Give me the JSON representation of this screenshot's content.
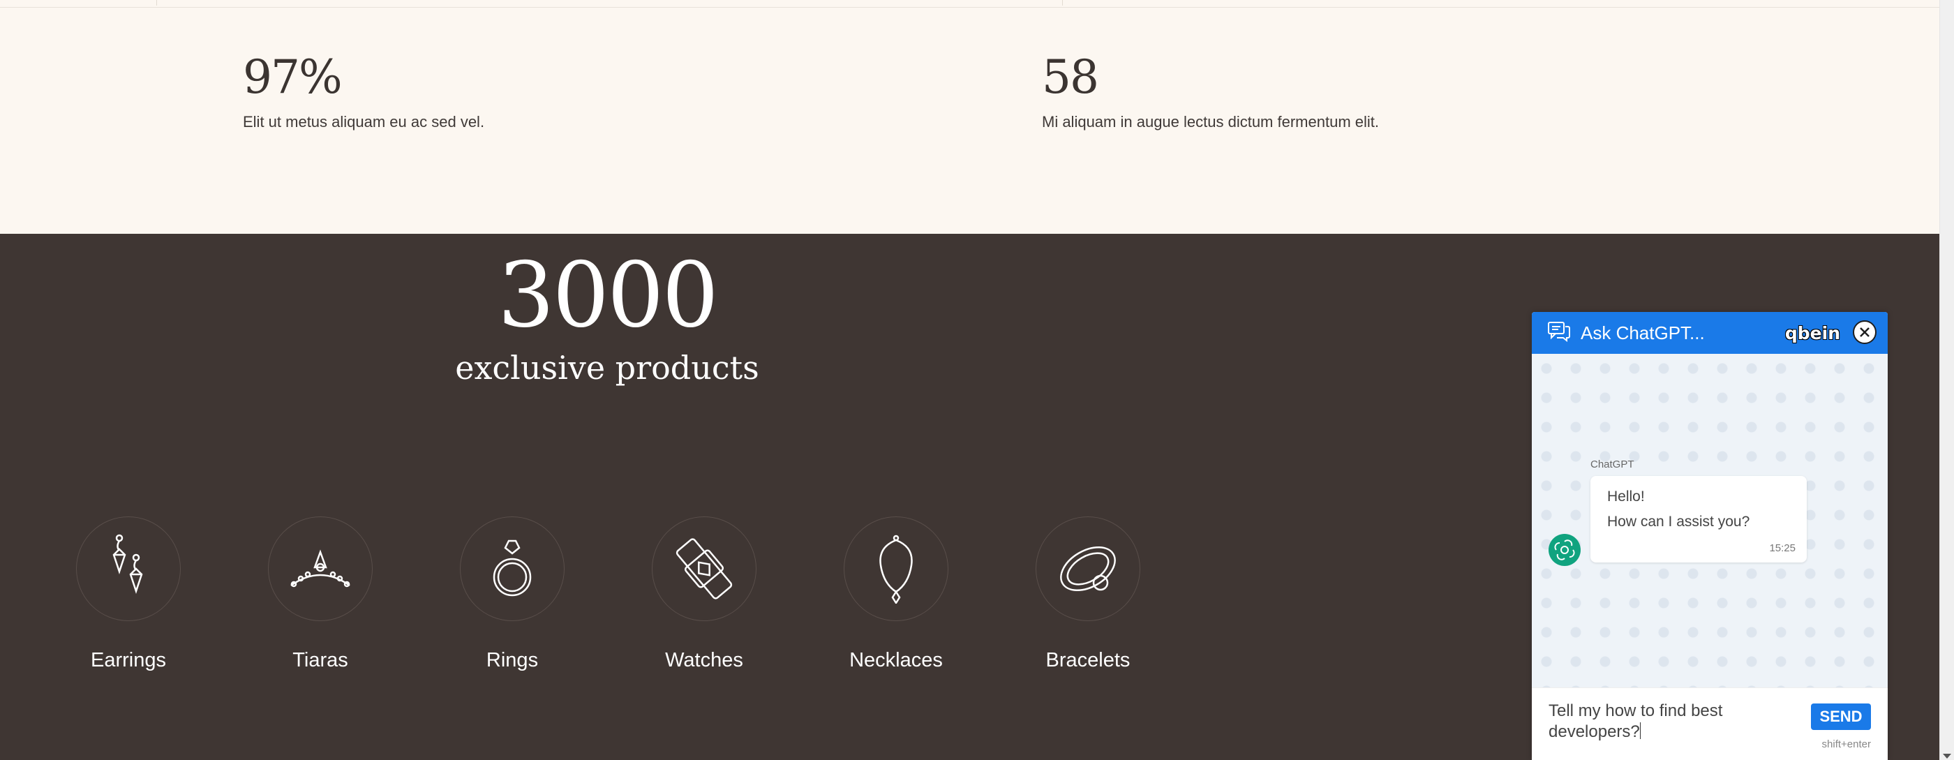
{
  "stats": [
    {
      "number": "97%",
      "text": "Elit ut metus aliquam eu ac sed vel."
    },
    {
      "number": "58",
      "text": "Mi aliquam in augue lectus dictum fermentum elit."
    }
  ],
  "highlight": {
    "number": "3000",
    "subtitle": "exclusive products"
  },
  "categories": [
    {
      "label": "Earrings",
      "icon": "earrings-icon"
    },
    {
      "label": "Tiaras",
      "icon": "tiara-icon"
    },
    {
      "label": "Rings",
      "icon": "ring-icon"
    },
    {
      "label": "Watches",
      "icon": "watch-icon"
    },
    {
      "label": "Necklaces",
      "icon": "necklace-icon"
    },
    {
      "label": "Bracelets",
      "icon": "bracelet-icon"
    }
  ],
  "chat": {
    "title": "Ask ChatGPT...",
    "brand": "qbein",
    "sender": "ChatGPT",
    "greeting_line1": "Hello!",
    "greeting_line2": "How can I assist you?",
    "time": "15:25",
    "input_value": "Tell my how to find best developers?",
    "send_label": "SEND",
    "hint": "shift+enter"
  },
  "colors": {
    "dark_section": "#3f3633",
    "page_bg": "#fcf7f1",
    "chat_accent": "#1a7ae8",
    "bot_avatar": "#10a37f"
  }
}
